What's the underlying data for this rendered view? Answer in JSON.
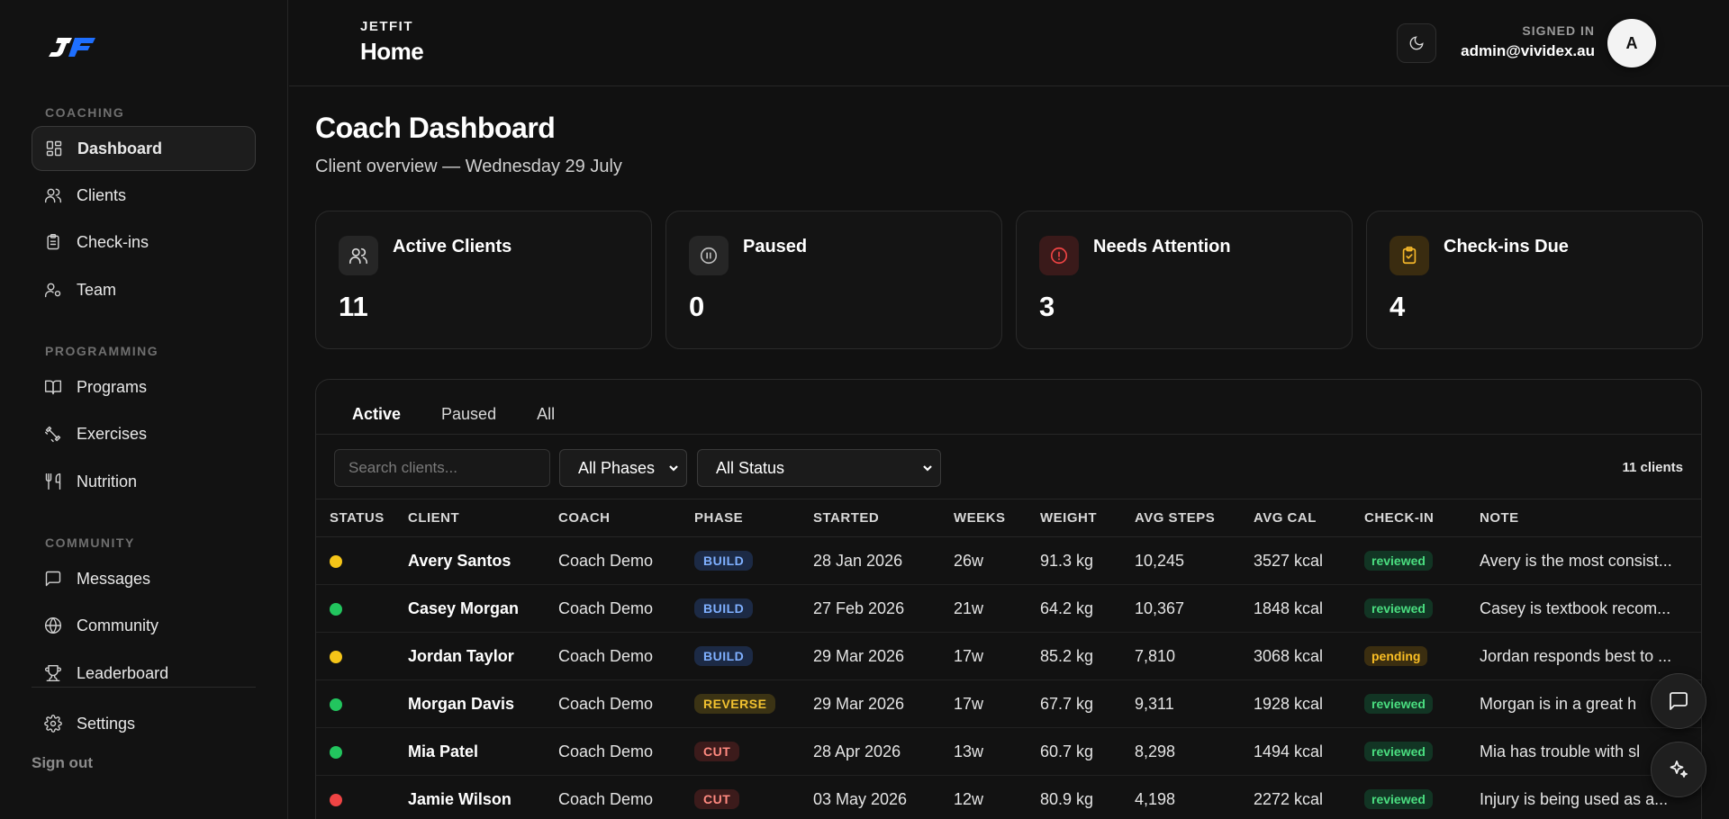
{
  "sidebar": {
    "sections": {
      "coaching": "COACHING",
      "programming": "PROGRAMMING",
      "community": "COMMUNITY"
    },
    "items": {
      "dashboard": "Dashboard",
      "clients": "Clients",
      "checkins": "Check-ins",
      "team": "Team",
      "programs": "Programs",
      "exercises": "Exercises",
      "nutrition": "Nutrition",
      "messages": "Messages",
      "community": "Community",
      "leaderboard": "Leaderboard",
      "settings": "Settings"
    },
    "signout": "Sign out"
  },
  "header": {
    "brand": "JETFIT",
    "title": "Home",
    "signed_in_label": "SIGNED IN",
    "email": "admin@vividex.au",
    "avatar_initial": "A"
  },
  "main": {
    "title": "Coach Dashboard",
    "subtitle": "Client overview — Wednesday 29 July"
  },
  "stats": {
    "active": {
      "label": "Active Clients",
      "value": "11"
    },
    "paused": {
      "label": "Paused",
      "value": "0"
    },
    "attention": {
      "label": "Needs Attention",
      "value": "3"
    },
    "checkins": {
      "label": "Check-ins Due",
      "value": "4"
    }
  },
  "panel": {
    "tabs": {
      "active": "Active",
      "paused": "Paused",
      "all": "All"
    },
    "search_placeholder": "Search clients...",
    "phase_filter": "All Phases",
    "status_filter": "All Status",
    "count": "11 clients"
  },
  "table": {
    "headers": {
      "status": "STATUS",
      "client": "CLIENT",
      "coach": "COACH",
      "phase": "PHASE",
      "started": "STARTED",
      "weeks": "WEEKS",
      "weight": "WEIGHT",
      "steps": "AVG STEPS",
      "cal": "AVG CAL",
      "checkin": "CHECK-IN",
      "note": "NOTE"
    },
    "rows": [
      {
        "status_color": "#f5c518",
        "client": "Avery Santos",
        "coach": "Coach Demo",
        "phase": "BUILD",
        "started": "28 Jan 2026",
        "weeks": "26w",
        "weight": "91.3 kg",
        "steps": "10,245",
        "cal": "3527 kcal",
        "checkin": "reviewed",
        "note": "Avery is the most consist..."
      },
      {
        "status_color": "#22c55e",
        "client": "Casey Morgan",
        "coach": "Coach Demo",
        "phase": "BUILD",
        "started": "27 Feb 2026",
        "weeks": "21w",
        "weight": "64.2 kg",
        "steps": "10,367",
        "cal": "1848 kcal",
        "checkin": "reviewed",
        "note": "Casey is textbook recom..."
      },
      {
        "status_color": "#f5c518",
        "client": "Jordan Taylor",
        "coach": "Coach Demo",
        "phase": "BUILD",
        "started": "29 Mar 2026",
        "weeks": "17w",
        "weight": "85.2 kg",
        "steps": "7,810",
        "cal": "3068 kcal",
        "checkin": "pending",
        "note": "Jordan responds best to ..."
      },
      {
        "status_color": "#22c55e",
        "client": "Morgan Davis",
        "coach": "Coach Demo",
        "phase": "REVERSE",
        "started": "29 Mar 2026",
        "weeks": "17w",
        "weight": "67.7 kg",
        "steps": "9,311",
        "cal": "1928 kcal",
        "checkin": "reviewed",
        "note": "Morgan is in a great h"
      },
      {
        "status_color": "#22c55e",
        "client": "Mia Patel",
        "coach": "Coach Demo",
        "phase": "CUT",
        "started": "28 Apr 2026",
        "weeks": "13w",
        "weight": "60.7 kg",
        "steps": "8,298",
        "cal": "1494 kcal",
        "checkin": "reviewed",
        "note": "Mia has trouble with sl"
      },
      {
        "status_color": "#ef4444",
        "client": "Jamie Wilson",
        "coach": "Coach Demo",
        "phase": "CUT",
        "started": "03 May 2026",
        "weeks": "12w",
        "weight": "80.9 kg",
        "steps": "4,198",
        "cal": "2272 kcal",
        "checkin": "reviewed",
        "note": "Injury is being used as a..."
      }
    ]
  },
  "colors": {
    "build_bg": "#1c2a45",
    "build_fg": "#7fb0ff",
    "reverse_bg": "#3b3314",
    "reverse_fg": "#f2c230",
    "cut_bg": "#3c1b1b",
    "cut_fg": "#ff8a80",
    "reviewed_bg": "#123524",
    "reviewed_fg": "#4ade80",
    "pending_bg": "#3b2e10",
    "pending_fg": "#fbbf24"
  },
  "icons": {
    "dashboard": "grid-icon",
    "clients": "users-icon",
    "checkins": "clipboard-icon",
    "team": "user-cog-icon",
    "programs": "book-icon",
    "exercises": "dumbbell-icon",
    "nutrition": "utensils-icon",
    "messages": "message-icon",
    "community": "globe-icon",
    "leaderboard": "trophy-icon",
    "settings": "gear-icon",
    "theme": "moon-icon",
    "chat": "chat-icon",
    "ai": "sparkles-icon"
  }
}
